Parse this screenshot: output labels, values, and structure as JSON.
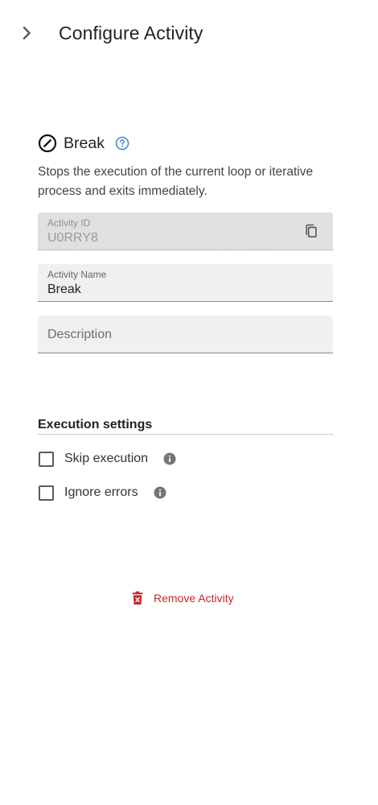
{
  "header": {
    "title": "Configure Activity"
  },
  "activity": {
    "name": "Break",
    "description": "Stops the execution of the current loop or iterative process and exits immediately."
  },
  "fields": {
    "activity_id": {
      "label": "Activity ID",
      "value": "U0RRY8"
    },
    "activity_name": {
      "label": "Activity Name",
      "value": "Break"
    },
    "description": {
      "placeholder": "Description"
    }
  },
  "execution": {
    "title": "Execution settings",
    "options": [
      {
        "label": "Skip execution",
        "checked": false
      },
      {
        "label": "Ignore errors",
        "checked": false
      }
    ]
  },
  "actions": {
    "remove_label": "Remove Activity"
  },
  "colors": {
    "danger": "#c62828",
    "help": "#3f85c9"
  }
}
